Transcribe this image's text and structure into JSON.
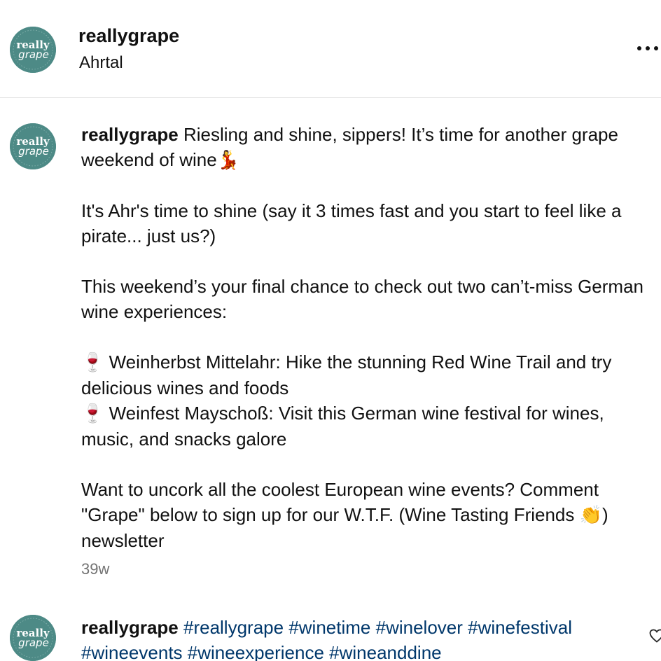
{
  "header": {
    "username": "reallygrape",
    "location": "Ahrtal"
  },
  "avatar": {
    "logo_text_top": "really",
    "logo_text_bottom": "grape",
    "color": "#4d8a86"
  },
  "caption": {
    "username": "reallygrape",
    "line1_text": "Riesling and shine, sippers! It’s time for another grape weekend of wine",
    "line1_emoji": "💃",
    "line2": "It's Ahr's time to shine (say it 3 times fast and you start to feel like a pirate... just us?)",
    "line3": "This weekend’s your final chance to check out two can’t-miss German wine experiences:",
    "item1_emoji": "🍷",
    "item1": "Weinherbst Mittelahr: Hike the stunning Red Wine Trail and try delicious wines and foods",
    "item2_emoji": "🍷",
    "item2": "Weinfest Mayschoß: Visit this German wine festival for wines, music, and snacks galore",
    "line4_text": "Want to uncork all the coolest European wine events? Comment \"Grape\" below to sign up for our W.T.F. (Wine Tasting Friends ",
    "line4_emoji": "👏",
    "line4_end": ") newsletter",
    "time": "39w"
  },
  "comment2": {
    "username": "reallygrape",
    "hashtags": [
      "#reallygrape",
      "#winetime",
      "#winelover",
      "#winefestival",
      "#wineevents",
      "#wineexperience",
      "#wineanddine"
    ]
  },
  "icons": {
    "more": "more-options-icon",
    "heart": "heart-icon"
  },
  "colors": {
    "hashtag": "#00376b",
    "timestamp": "#737373",
    "divider": "#e3e3e3"
  }
}
